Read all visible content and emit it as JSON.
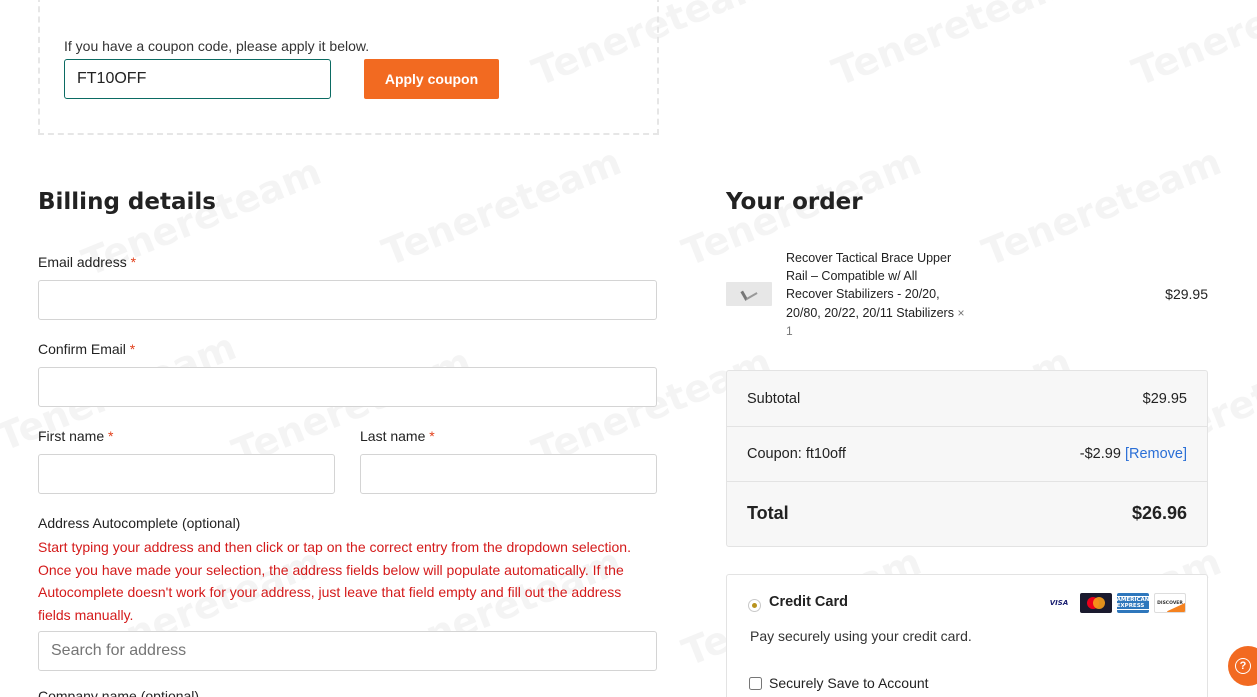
{
  "coupon": {
    "prompt": "If you have a coupon code, please apply it below.",
    "code_value": "FT10OFF",
    "apply_label": "Apply coupon"
  },
  "billing": {
    "title": "Billing details",
    "required_marker": "*",
    "email_label": "Email address",
    "confirm_email_label": "Confirm Email",
    "first_name_label": "First name",
    "last_name_label": "Last name",
    "autocomplete_label": "Address Autocomplete (optional)",
    "autocomplete_help": "Start typing your address and then click or tap on the correct entry from the dropdown selection. Once you have made your selection, the address fields below will populate automatically. If the Autocomplete doesn't work for your address, just leave that field empty and fill out the address fields manually.",
    "search_placeholder": "Search for address",
    "next_label": "Company name (optional)"
  },
  "order": {
    "title": "Your order",
    "item": {
      "name": "Recover Tactical Brace Upper Rail – Compatible w/ All Recover Stabilizers - 20/20, 20/80, 20/22, 20/11 Stabilizers",
      "qty": "× 1",
      "price": "$29.95"
    },
    "subtotal_label": "Subtotal",
    "subtotal_value": "$29.95",
    "coupon_label": "Coupon: ft10off",
    "coupon_value": "-$2.99",
    "remove_label": "[Remove]",
    "total_label": "Total",
    "total_value": "$26.96"
  },
  "payment": {
    "method_label": "Credit Card",
    "description": "Pay securely using your credit card.",
    "save_label": "Securely Save to Account",
    "cards": [
      "VISA",
      "Mastercard",
      "AMERICAN EXPRESS",
      "DISCOVER"
    ]
  },
  "watermark": "Tenereteam",
  "colors": {
    "accent": "#f26a21",
    "required": "#e2401c",
    "help_text": "#d41a1a",
    "link": "#2a6fd6",
    "input_focus": "#0b6b63"
  },
  "icons": {
    "help": "help-question-icon",
    "thumb": "product-thumbnail"
  }
}
